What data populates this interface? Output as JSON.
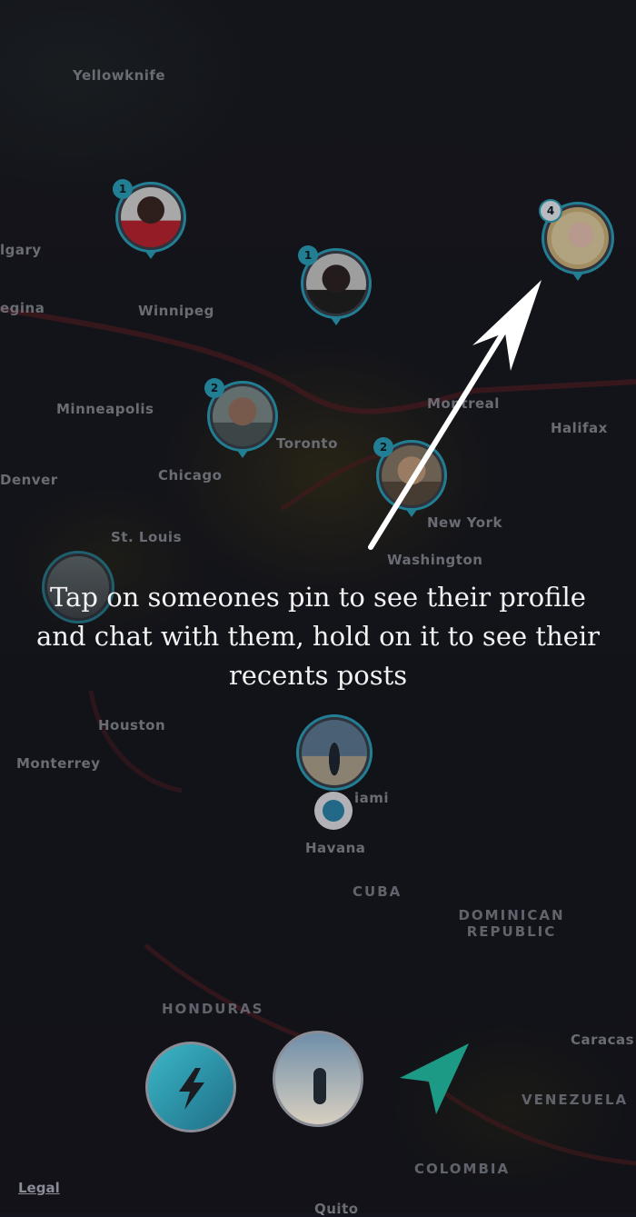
{
  "map": {
    "cities": [
      "Yellowknife",
      "lgary",
      "egina",
      "Winnipeg",
      "Minneapolis",
      "Toronto",
      "Chicago",
      "Denver",
      "Montreal",
      "Halifax",
      "New York",
      "St. Louis",
      "Washington",
      "Houston",
      "Monterrey",
      "iami",
      "Havana",
      "Quito",
      "Caracas"
    ],
    "countries": [
      "CUBA",
      "DOMINICAN REPUBLIC",
      "HONDURAS",
      "VENEZUELA",
      "COLOMBIA"
    ],
    "legal_link": "Legal"
  },
  "pins": [
    {
      "badge": "1"
    },
    {
      "badge": "1"
    },
    {
      "badge": "2"
    },
    {
      "badge": "2"
    },
    {
      "badge": "4"
    },
    {
      "badge": ""
    },
    {
      "badge": ""
    }
  ],
  "hint_text": "Tap on someones pin to see their profile and chat with them, hold on it to see their recents posts",
  "toolbar": {
    "icons": [
      "lightning-icon",
      "user-photo",
      "navigation-arrow-icon"
    ]
  },
  "colors": {
    "accent": "#2aa6bf",
    "map_bg": "#15161d",
    "city_text": "#8a8d96"
  }
}
